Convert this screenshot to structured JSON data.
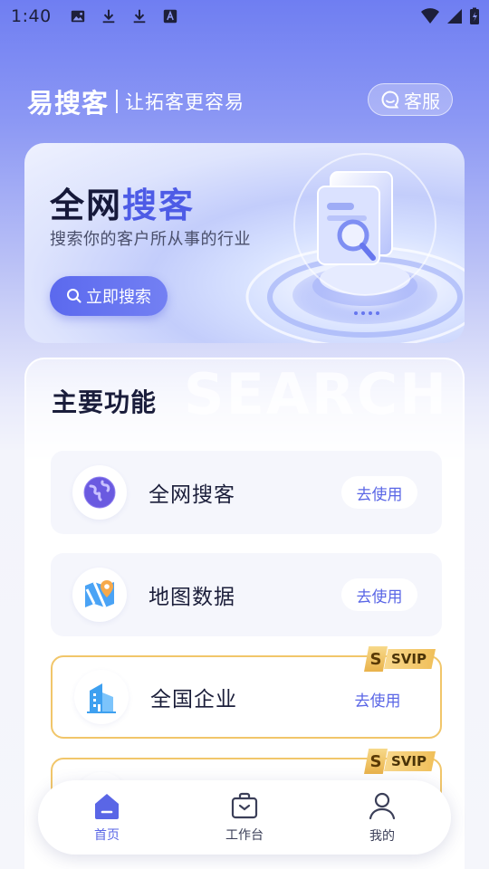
{
  "status_bar": {
    "time": "1:40",
    "left_icons": [
      "image-icon",
      "download-icon",
      "download-icon",
      "text-a-icon"
    ],
    "right_icons": [
      "wifi-icon",
      "signal-icon",
      "battery-charging-icon"
    ]
  },
  "header": {
    "brand": "易搜客",
    "slogan": "让拓客更容易",
    "service_label": "客服"
  },
  "banner": {
    "title_plain": "全网",
    "title_accent": "搜客",
    "subtitle": "搜索你的客户所从事的行业",
    "button_label": "立即搜索"
  },
  "main": {
    "watermark": "SEARCH",
    "section_title": "主要功能",
    "features": [
      {
        "name": "全网搜客",
        "button": "去使用",
        "icon": "globe-icon",
        "vip": false
      },
      {
        "name": "地图数据",
        "button": "去使用",
        "icon": "map-pin-icon",
        "vip": false
      },
      {
        "name": "全国企业",
        "button": "去使用",
        "icon": "building-icon",
        "vip": true,
        "badge_mark": "S",
        "badge_text": "SVIP"
      },
      {
        "name": "",
        "button": "",
        "icon": "",
        "vip": true,
        "badge_mark": "S",
        "badge_text": "SVIP"
      }
    ]
  },
  "bottom_nav": {
    "items": [
      {
        "label": "首页",
        "icon": "home-icon",
        "active": true
      },
      {
        "label": "工作台",
        "icon": "briefcase-icon",
        "active": false
      },
      {
        "label": "我的",
        "icon": "user-icon",
        "active": false
      }
    ]
  },
  "colors": {
    "accent": "#5a66e6",
    "vip_gold": "#f1c66a",
    "text_dark": "#1b1e3a"
  }
}
